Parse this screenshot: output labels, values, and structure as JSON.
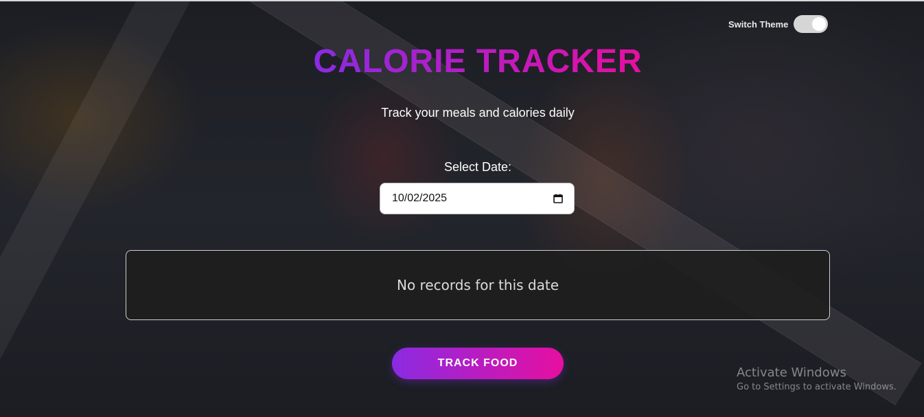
{
  "theme_switch": {
    "label": "Switch Theme",
    "state": "on"
  },
  "header": {
    "title": "CALORIE TRACKER",
    "subtitle": "Track your meals and calories daily"
  },
  "date_picker": {
    "label": "Select Date:",
    "value": "10/02/2025",
    "icon": "calendar-icon"
  },
  "records": {
    "empty_message": "No records for this date"
  },
  "actions": {
    "track_food_label": "TRACK FOOD"
  },
  "watermark": {
    "title": "Activate Windows",
    "subtitle": "Go to Settings to activate Windows."
  },
  "colors": {
    "gradient_start": "#8a2be2",
    "gradient_end": "#e60fa0",
    "background": "#1a1c22",
    "panel": "#1e1e1e"
  }
}
